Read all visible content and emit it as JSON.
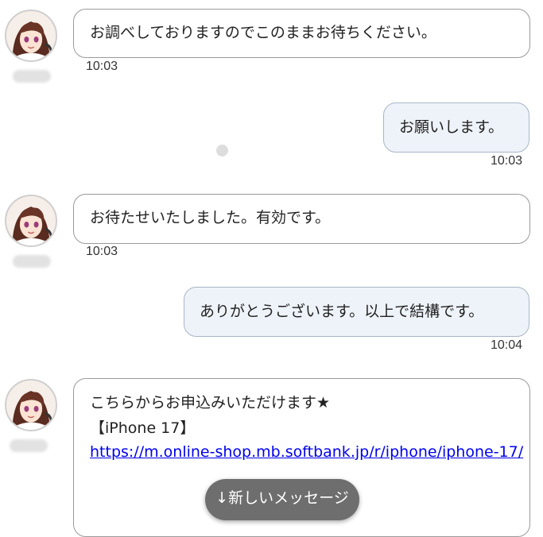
{
  "messages": [
    {
      "text": "お調べしておりますのでこのままお待ちください。",
      "time": "10:03"
    },
    {
      "text": "お願いします。",
      "time": "10:03"
    },
    {
      "text": "お待たせいたしました。有効です。",
      "time": "10:03"
    },
    {
      "text": "ありがとうございます。以上で結構です。",
      "time": "10:04"
    },
    {
      "line1": "こちらからお申込みいただけます★",
      "line2": "【iPhone 17】",
      "link": "https://m.online-shop.mb.softbank.jp/r/iphone/iphone-17/"
    }
  ],
  "new_message_button": "↓新しいメッセージ",
  "colors": {
    "operator_bubble": "#ffffff",
    "user_bubble": "#eef3f9",
    "link": "#0000ee",
    "new_message_button": "#6e6e6e"
  },
  "icons": {
    "operator_avatar": "operator-avatar-icon",
    "typing_indicator": "dot-icon"
  }
}
